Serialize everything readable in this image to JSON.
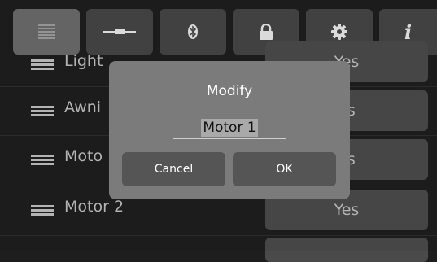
{
  "toolbar": {
    "buttons": [
      {
        "icon": "list-icon",
        "selected": true
      },
      {
        "icon": "connector-icon",
        "selected": false
      },
      {
        "icon": "bluetooth-icon",
        "selected": false
      },
      {
        "icon": "lock-icon",
        "selected": false
      },
      {
        "icon": "gear-icon",
        "selected": false
      },
      {
        "icon": "info-icon",
        "selected": false
      }
    ],
    "info_glyph": "i"
  },
  "list": {
    "rows": [
      {
        "name": "Light",
        "value": "Yes"
      },
      {
        "name": "Awni",
        "value": "es"
      },
      {
        "name": "Moto",
        "value": "es"
      },
      {
        "name": "Motor 2",
        "value": "Yes"
      }
    ]
  },
  "dialog": {
    "title": "Modify",
    "input_value": "Motor 1",
    "cancel_label": "Cancel",
    "ok_label": "OK"
  },
  "colors": {
    "background": "#1e1e1e",
    "button": "#454545",
    "button_selected": "#6a6a6a",
    "dialog": "#7b7b7b",
    "dialog_button": "#555555"
  }
}
